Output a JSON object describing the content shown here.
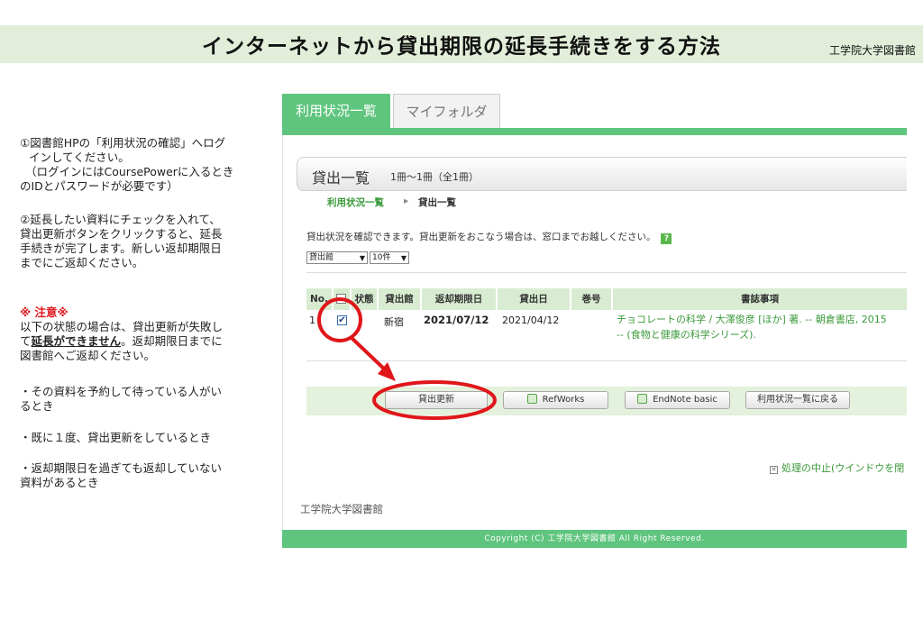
{
  "page": {
    "title": "インターネットから貸出期限の延長手続きをする方法",
    "org": "工学院大学図書館"
  },
  "instructions": {
    "step1_l1": "①図書館HPの「利用状況の確認」へログ",
    "step1_l2": "インしてください。",
    "step1_l3": "（ログインにはCoursePowerに入るとき",
    "step1_l4": "のIDとパスワードが必要です）",
    "step2_l1": "②延長したい資料にチェックを入れて、",
    "step2_l2": "貸出更新ボタンをクリックすると、延長",
    "step2_l3": "手続きが完了します。新しい返却期限日",
    "step2_l4": "までにご返却ください。",
    "note_head": "※ 注意※",
    "note_l1": "以下の状態の場合は、貸出更新が失敗し",
    "note_l2a": "て",
    "note_l2b": "延長ができません",
    "note_l2c": "。返却期限日までに",
    "note_l3": "図書館へご返却ください。",
    "case1_l1": "・その資料を予約して待っている人がい",
    "case1_l2": "るとき",
    "case2": "・既に１度、貸出更新をしているとき",
    "case3_l1": "・返却期限日を過ぎても返却していない",
    "case3_l2": "資料があるとき"
  },
  "screenshot": {
    "tabs": [
      "利用状況一覧",
      "マイフォルダ"
    ],
    "header_title": "貸出一覧",
    "header_count": "1冊～1冊（全1冊）",
    "breadcrumb": [
      "利用状況一覧",
      "▸",
      "貸出一覧"
    ],
    "description": "貸出状況を確認できます。貸出更新をおこなう場合は、窓口までお越しください。",
    "help_icon": "?",
    "sort_select": "貸出館",
    "count_select": "10件",
    "select_arrow": "▼",
    "columns": [
      "No.",
      "状態",
      "貸出館",
      "返却期限日",
      "貸出日",
      "巻号",
      "書誌事項"
    ],
    "row": {
      "no": "1",
      "checked_mark": "✔",
      "branch": "新宿",
      "due": "2021/07/12",
      "lent": "2021/04/12",
      "book_l1": "チョコレートの科学 / 大澤俊彦 [ほか] 著. -- 朝倉書店, 2015",
      "book_l2": "-- (食物と健康の科学シリーズ)."
    },
    "buttons": {
      "renew": "貸出更新",
      "refworks": "RefWorks",
      "endnote": "EndNote basic",
      "back": "利用状況一覧に戻る"
    },
    "cancel_mark": "✕",
    "cancel": "処理の中止(ウインドウを閉",
    "footer_org": "工学院大学図書館",
    "copyright": "Copyright (C) 工学院大学図書館 All Right Reserved."
  },
  "colors": {
    "accent_green": "#5fc57e",
    "annotation_red": "#e0161a",
    "title_band": "#e2eed9"
  }
}
